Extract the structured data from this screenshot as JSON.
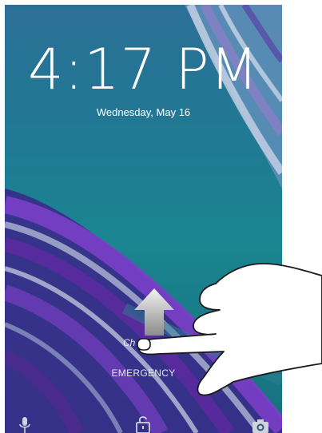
{
  "lockscreen": {
    "time": "4:17 PM",
    "date": "Wednesday, May 16",
    "charging_text": "Ch",
    "emergency_label": "EMERGENCY"
  },
  "icons": {
    "voice": "microphone-icon",
    "unlock": "unlock-icon",
    "camera": "camera-icon"
  },
  "colors": {
    "wallpaper_top": "#2b6f97",
    "wallpaper_bottom": "#17707c",
    "swirl_purple": "#5b2a9e",
    "swirl_silver": "#b9c3d6"
  }
}
